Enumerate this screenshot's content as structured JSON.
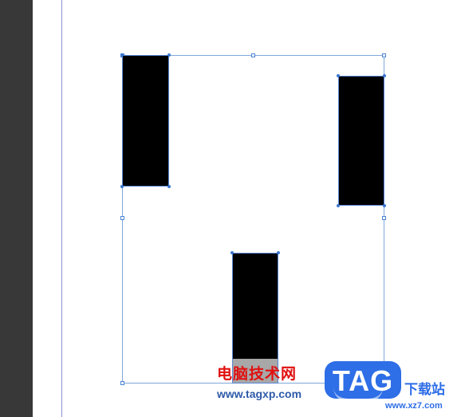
{
  "watermark": {
    "site_name_cn": "电脑技术网",
    "site_url": "www.tagxp.com",
    "badge_text": "TAG",
    "download_cn": "下载站",
    "download_url": "www.xz7.com"
  },
  "colors": {
    "pasteboard": "#383838",
    "selection": "#7fa7dc",
    "shape_fill": "#000000",
    "watermark_red": "#e01010",
    "badge_blue": "#2e6ee6"
  }
}
